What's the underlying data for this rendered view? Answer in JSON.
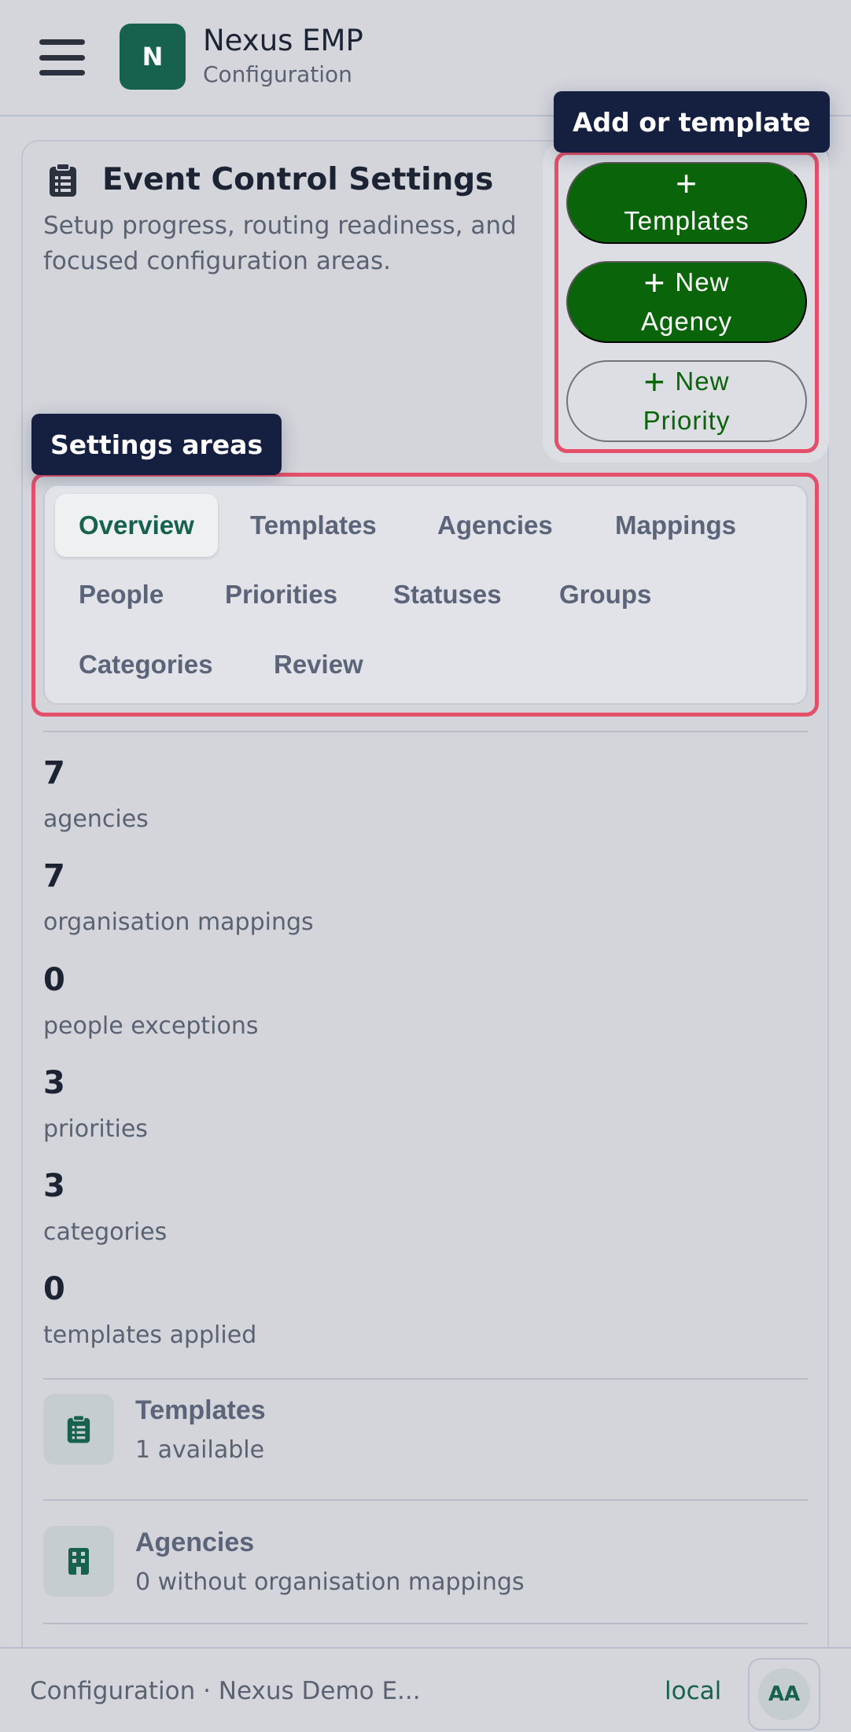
{
  "header": {
    "brand_letter": "N",
    "app_name": "Nexus EMP",
    "app_section": "Configuration"
  },
  "card": {
    "title": "Event Control Settings",
    "description": "Setup progress, routing readiness, and focused configuration areas."
  },
  "actions": {
    "tag": "Add or template",
    "buttons": [
      {
        "line1": "Templates",
        "line2": ""
      },
      {
        "line1": "New",
        "line2": "Agency"
      },
      {
        "line1": "New",
        "line2": "Priority"
      }
    ]
  },
  "settings_areas": {
    "tag": "Settings areas",
    "tabs": [
      "Overview",
      "Templates",
      "Agencies",
      "Mappings",
      "People",
      "Priorities",
      "Statuses",
      "Groups",
      "Categories",
      "Review"
    ],
    "active_tab": "Overview"
  },
  "stats": [
    {
      "value": "7",
      "label": "agencies"
    },
    {
      "value": "7",
      "label": "organisation mappings"
    },
    {
      "value": "0",
      "label": "people exceptions"
    },
    {
      "value": "3",
      "label": "priorities"
    },
    {
      "value": "3",
      "label": "categories"
    },
    {
      "value": "0",
      "label": "templates applied"
    }
  ],
  "areas": [
    {
      "title": "Templates",
      "subtitle": "1 available",
      "icon": "clipboard-icon"
    },
    {
      "title": "Agencies",
      "subtitle": "0 without organisation mappings",
      "icon": "building-icon"
    }
  ],
  "footer": {
    "context": "Configuration · Nexus Demo E...",
    "environment": "local",
    "avatar_initials": "AA"
  },
  "colors": {
    "brand": "#17614f",
    "primary_button": "#0a6409",
    "highlight": "#e4506a",
    "tag_bg": "#152041"
  }
}
